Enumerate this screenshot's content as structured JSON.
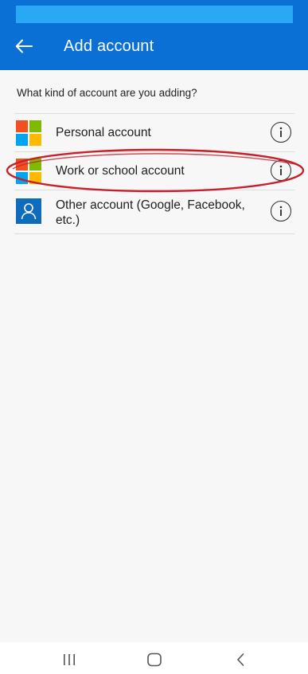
{
  "app_bar": {
    "title": "Add account",
    "colors": {
      "bar": "#0a70d6",
      "status_strip": "#29a8f3"
    }
  },
  "prompt": "What kind of account are you adding?",
  "accounts": [
    {
      "label": "Personal account",
      "icon": "microsoft-logo-icon"
    },
    {
      "label": "Work or school account",
      "icon": "microsoft-logo-icon",
      "highlighted": true
    },
    {
      "label": "Other account (Google, Facebook, etc.)",
      "icon": "person-icon"
    }
  ],
  "info_icon": "info-icon",
  "annotation": {
    "shape": "ellipse",
    "color": "#c8202a",
    "target": "Work or school account"
  },
  "microsoft_logo_colors": [
    "#f25022",
    "#7fba00",
    "#00a4ef",
    "#ffb900"
  ],
  "nav_bar": {
    "buttons": [
      "recent-apps-icon",
      "home-icon",
      "back-icon"
    ]
  }
}
